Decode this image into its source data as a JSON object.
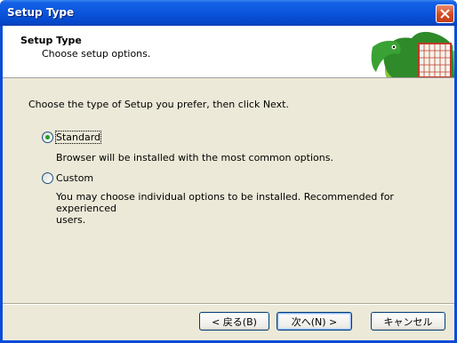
{
  "window": {
    "title": "Setup Type"
  },
  "header": {
    "title": "Setup Type",
    "subtitle": "Choose setup options."
  },
  "body": {
    "intro": "Choose the type of Setup you prefer, then click Next.",
    "options": [
      {
        "label": "Standard",
        "description": "Browser will be installed with the most common options.",
        "selected": true
      },
      {
        "label": "Custom",
        "description_line1": "You may choose individual options to be installed. Recommended for experienced",
        "description_line2": "users.",
        "selected": false
      }
    ]
  },
  "buttons": {
    "back": "< 戻る(B)",
    "next": "次へ(N) >",
    "cancel": "キャンセル"
  },
  "colors": {
    "titlebar": "#0a55dc",
    "dialog_bg": "#ece9d8",
    "radio_dot": "#21a121",
    "close": "#d24b22"
  },
  "icons": {
    "close": "close-x-icon",
    "header_art": "mozilla-lizard-logo"
  }
}
